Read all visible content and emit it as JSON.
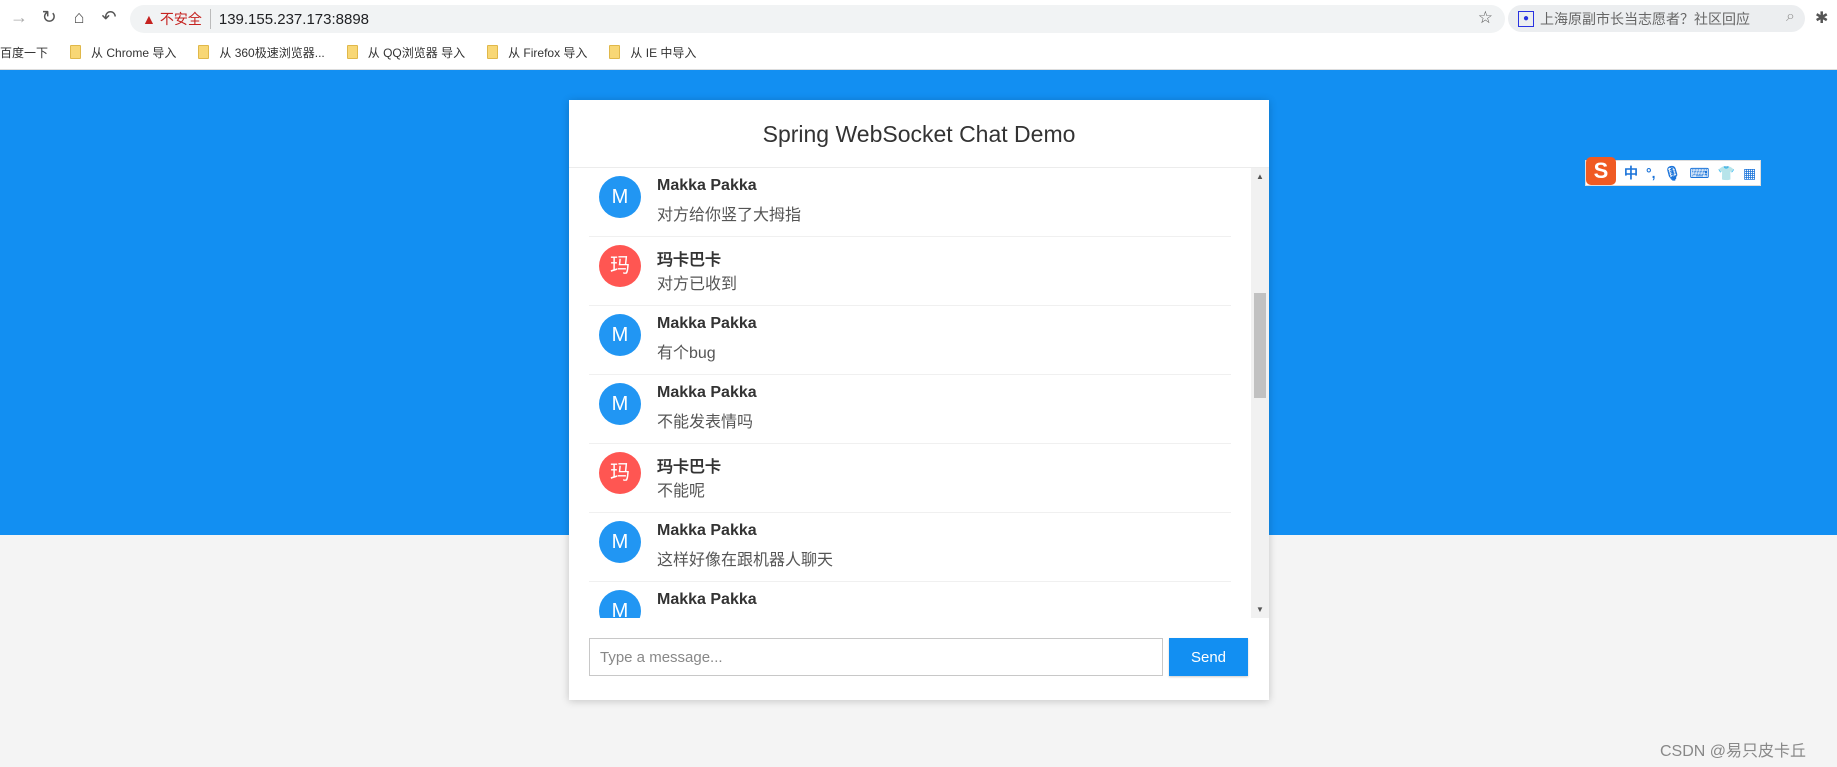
{
  "browser": {
    "security_label": "不安全",
    "url": "139.155.237.173:8898",
    "search_text": "上海原副市长当志愿者？社区回应",
    "bookmarks": [
      "百度一下",
      "从 Chrome 导入",
      "从 360极速浏览器...",
      "从 QQ浏览器 导入",
      "从 Firefox 导入",
      "从 IE 中导入"
    ]
  },
  "ime": {
    "mode": "中",
    "punct": "°,"
  },
  "chat": {
    "title": "Spring WebSocket Chat Demo",
    "messages": [
      {
        "initial": "M",
        "name": "Makka Pakka",
        "text": "对方给你竖了大拇指",
        "color": "#2196f3"
      },
      {
        "initial": "玛",
        "name": "玛卡巴卡",
        "text": "对方已收到",
        "color": "#ff5652"
      },
      {
        "initial": "M",
        "name": "Makka Pakka",
        "text": "有个bug",
        "color": "#2196f3"
      },
      {
        "initial": "M",
        "name": "Makka Pakka",
        "text": "不能发表情吗",
        "color": "#2196f3"
      },
      {
        "initial": "玛",
        "name": "玛卡巴卡",
        "text": "不能呢",
        "color": "#ff5652"
      },
      {
        "initial": "M",
        "name": "Makka Pakka",
        "text": "这样好像在跟机器人聊天",
        "color": "#2196f3"
      },
      {
        "initial": "M",
        "name": "Makka Pakka",
        "text": "",
        "color": "#2196f3"
      }
    ],
    "input_placeholder": "Type a message...",
    "send_label": "Send"
  },
  "watermark": "CSDN @易只皮卡丘"
}
